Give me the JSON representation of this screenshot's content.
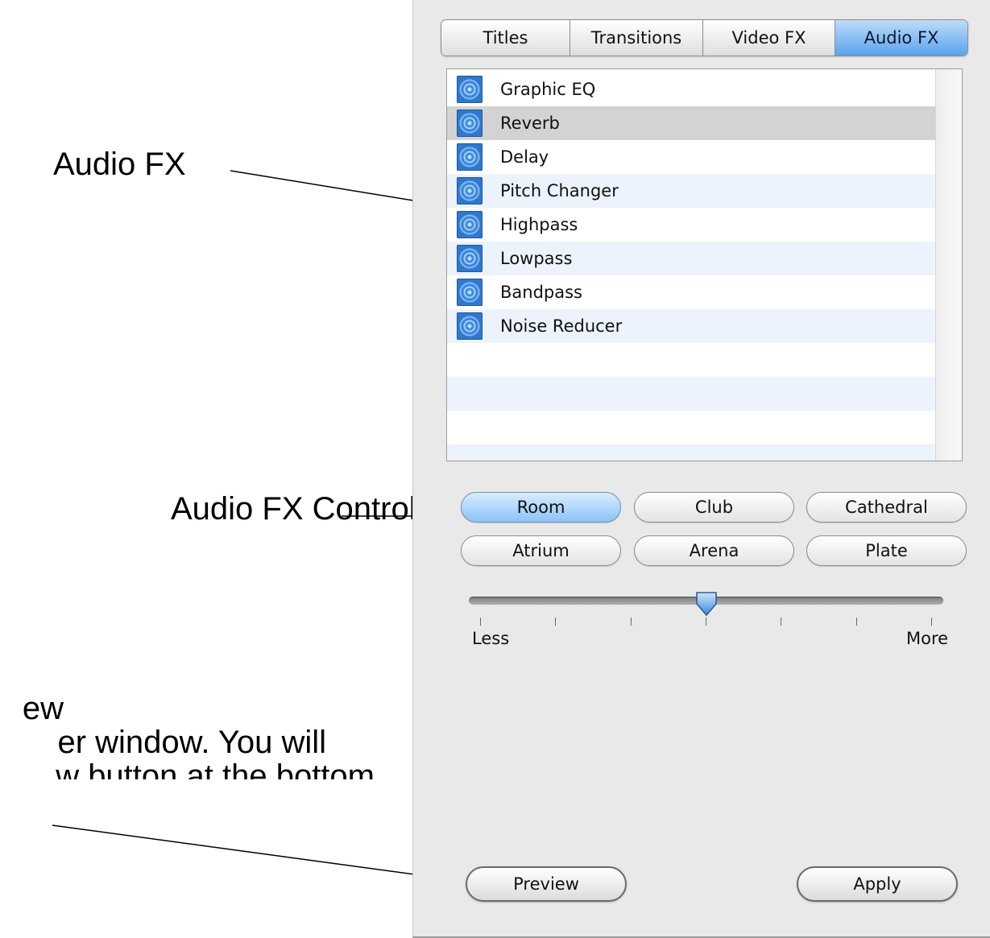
{
  "annotations": {
    "audio_fx_label": "Audio FX",
    "audio_fx_controls_label": "Audio FX Controls",
    "preview_note_lines": [
      "ew",
      "er window.  You will",
      "w button at the bottom"
    ]
  },
  "tabs": [
    {
      "label": "Titles",
      "active": false
    },
    {
      "label": "Transitions",
      "active": false
    },
    {
      "label": "Video FX",
      "active": false
    },
    {
      "label": "Audio FX",
      "active": true
    }
  ],
  "effects": [
    {
      "label": "Graphic EQ",
      "icon": "audio-fx-icon"
    },
    {
      "label": "Reverb",
      "icon": "audio-fx-icon",
      "selected": true
    },
    {
      "label": "Delay",
      "icon": "audio-fx-icon"
    },
    {
      "label": "Pitch Changer",
      "icon": "audio-fx-icon"
    },
    {
      "label": "Highpass",
      "icon": "audio-fx-icon"
    },
    {
      "label": "Lowpass",
      "icon": "audio-fx-icon"
    },
    {
      "label": "Bandpass",
      "icon": "audio-fx-icon"
    },
    {
      "label": "Noise Reducer",
      "icon": "audio-fx-icon"
    }
  ],
  "presets": [
    {
      "label": "Room",
      "active": true
    },
    {
      "label": "Club",
      "active": false
    },
    {
      "label": "Cathedral",
      "active": false
    },
    {
      "label": "Atrium",
      "active": false
    },
    {
      "label": "Arena",
      "active": false
    },
    {
      "label": "Plate",
      "active": false
    }
  ],
  "slider": {
    "min_label": "Less",
    "max_label": "More",
    "value_fraction": 0.5,
    "tick_count": 7
  },
  "buttons": {
    "preview": "Preview",
    "apply": "Apply"
  },
  "colors": {
    "panel_bg": "#e9e9e9",
    "active_tab": "#5aa3ec",
    "selected_row": "#d3d3d3",
    "alt_row": "#ecf3fd"
  }
}
